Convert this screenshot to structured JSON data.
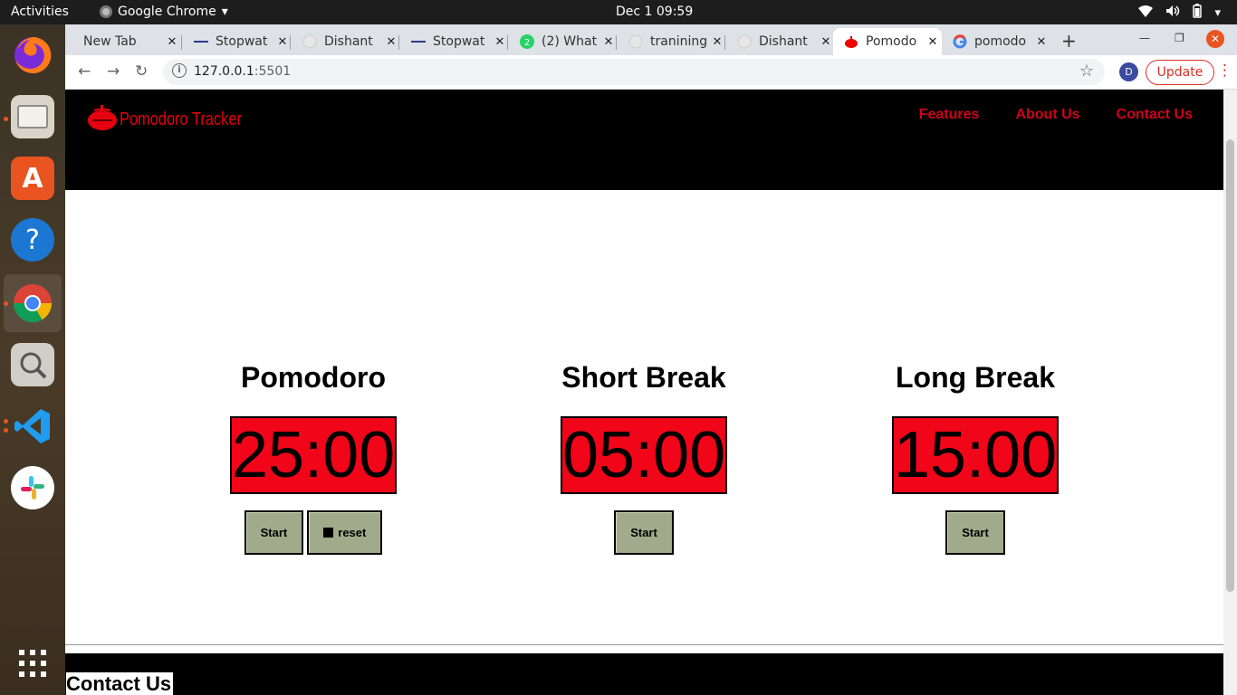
{
  "system": {
    "activities": "Activities",
    "app_name": "Google Chrome",
    "clock": "Dec 1  09:59"
  },
  "dock": {
    "items": [
      "firefox-icon",
      "files-icon",
      "app-store-icon",
      "help-icon",
      "chrome-icon",
      "screenshot-icon",
      "vscode-icon",
      "slack-icon",
      "apps-grid-icon"
    ]
  },
  "browser": {
    "tabs": [
      {
        "title": "New Tab",
        "active": false
      },
      {
        "title": "Stopwat",
        "active": false
      },
      {
        "title": "Dishant",
        "active": false
      },
      {
        "title": "Stopwat",
        "active": false
      },
      {
        "title": "(2) What",
        "active": false
      },
      {
        "title": "tranining",
        "active": false
      },
      {
        "title": "Dishant",
        "active": false
      },
      {
        "title": "Pomodo",
        "active": true
      },
      {
        "title": "pomodo",
        "active": false
      }
    ],
    "url_host": "127.0.0.1",
    "url_port": ":5501",
    "profile_initial": "D",
    "update_label": "Update"
  },
  "site": {
    "brand": "Pomodoro Tracker",
    "nav": {
      "features": "Features",
      "about": "About Us",
      "contact": "Contact Us"
    },
    "timers": [
      {
        "title": "Pomodoro",
        "time": "25:00",
        "start_label": "Start",
        "reset_label": "reset"
      },
      {
        "title": "Short Break",
        "time": "05:00",
        "start_label": "Start"
      },
      {
        "title": "Long Break",
        "time": "15:00",
        "start_label": "Start"
      }
    ],
    "footer_heading": "Contact Us"
  },
  "colors": {
    "brand_red": "#e5000f",
    "timer_bg": "#f10519",
    "button_bg": "#a1ab8b",
    "header_bg": "#000000"
  }
}
